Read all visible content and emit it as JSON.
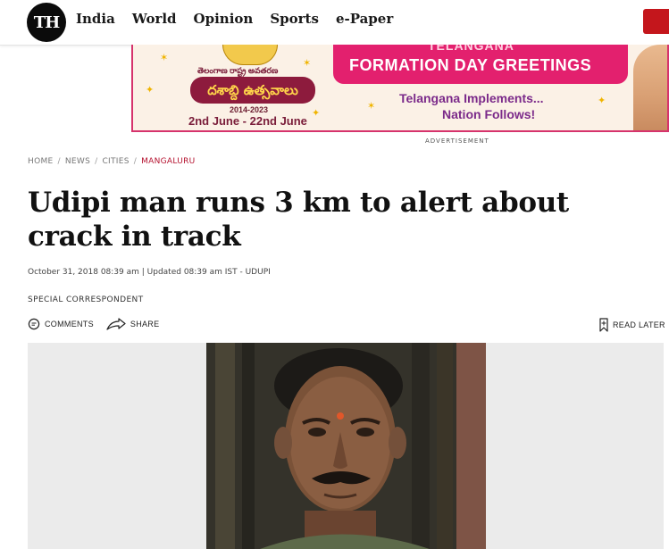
{
  "header": {
    "logo_text": "TH",
    "nav": [
      "India",
      "World",
      "Opinion",
      "Sports",
      "e-Paper"
    ]
  },
  "ad": {
    "telugu_small": "తెలంగాణ రాష్ట్ర అవతరణ",
    "telugu_big": "దశాబ్ది ఉత్సవాలు",
    "years": "2014-2023",
    "dates": "2nd June - 22nd June",
    "top_word": "TELANGANA",
    "title": "FORMATION DAY GREETINGS",
    "line1": "Telangana Implements...",
    "line2": "Nation Follows!",
    "label": "ADVERTISEMENT"
  },
  "breadcrumb": {
    "items": [
      "HOME",
      "NEWS",
      "CITIES"
    ],
    "current": "MANGALURU"
  },
  "article": {
    "title": "Udipi man runs 3 km to alert about crack in track",
    "dateline": "October 31, 2018 08:39 am | Updated 08:39 am IST - UDUPI",
    "author": "SPECIAL CORRESPONDENT",
    "comments_label": "COMMENTS",
    "share_label": "SHARE",
    "read_later_label": "READ LATER"
  },
  "colors": {
    "accent": "#b5122f",
    "subscribe": "#c4161c",
    "ad_pink": "#e3206e"
  }
}
